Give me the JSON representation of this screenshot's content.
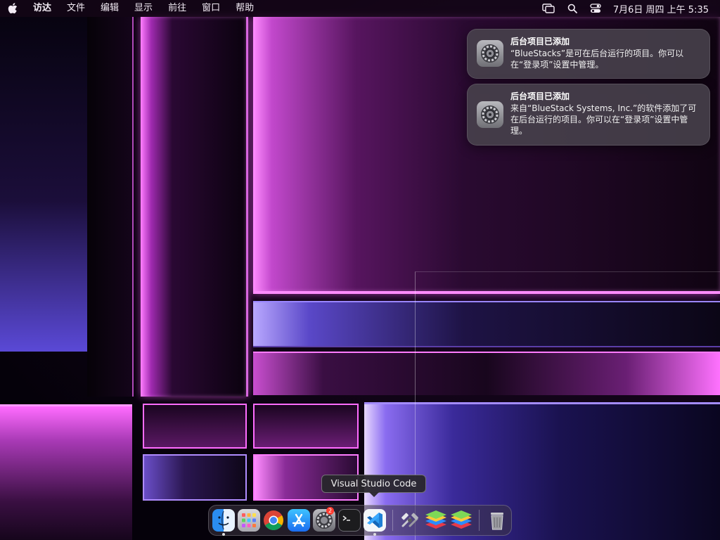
{
  "menubar": {
    "apple_icon": "apple-icon",
    "items": [
      "访达",
      "文件",
      "编辑",
      "显示",
      "前往",
      "窗口",
      "帮助"
    ],
    "status_icons": [
      "screen-mirror-icon",
      "search-icon",
      "control-center-icon"
    ],
    "clock": "7月6日 周四 上午 5:35"
  },
  "notifications": [
    {
      "title": "后台项目已添加",
      "body": "“BlueStacks”是可在后台运行的项目。你可以在“登录项”设置中管理。",
      "icon": "system-settings-icon"
    },
    {
      "title": "后台项目已添加",
      "body": "来自“BlueStack Systems, Inc.”的软件添加了可在后台运行的项目。你可以在“登录项”设置中管理。",
      "icon": "system-settings-icon"
    }
  ],
  "tooltip": "Visual Studio Code",
  "dock": {
    "apps": [
      {
        "name": "finder-icon",
        "running": true
      },
      {
        "name": "launchpad-icon",
        "running": false
      },
      {
        "name": "chrome-icon",
        "running": false
      },
      {
        "name": "app-store-icon",
        "running": false
      },
      {
        "name": "system-settings-icon",
        "running": false,
        "badge": "2"
      },
      {
        "name": "terminal-icon",
        "running": false
      },
      {
        "name": "vscode-icon",
        "running": true
      },
      {
        "name": "bluestacks-services-icon",
        "running": false
      },
      {
        "name": "bluestacks-icon",
        "running": false
      },
      {
        "name": "bluestacks-x-icon",
        "running": false
      },
      {
        "name": "trash-icon",
        "running": false
      }
    ]
  },
  "colors": {
    "accent_magenta": "#ff5cff",
    "accent_violet": "#7a5cff",
    "badge_red": "#ff3b30"
  }
}
